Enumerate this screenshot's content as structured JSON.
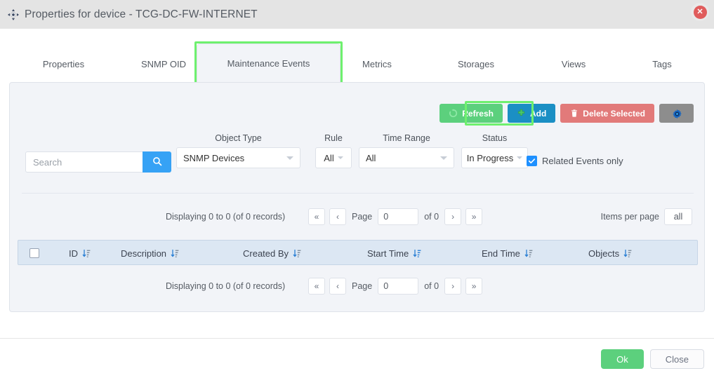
{
  "window": {
    "title": "Properties for device - TCG-DC-FW-INTERNET",
    "title_icon": "move-resize-icon",
    "close_icon": "close-circle-icon",
    "accent_green": "#6ef06e",
    "accent_blue": "#1b8fc4",
    "accent_red": "#e27a7a",
    "accent_success": "#5cd07d"
  },
  "tabs": [
    {
      "label": "Properties",
      "active": false
    },
    {
      "label": "SNMP OID",
      "active": false
    },
    {
      "label": "Maintenance Events",
      "active": true
    },
    {
      "label": "Metrics",
      "active": false
    },
    {
      "label": "Storages",
      "active": false
    },
    {
      "label": "Views",
      "active": false
    },
    {
      "label": "Tags",
      "active": false
    }
  ],
  "toolbar": {
    "refresh_label": "Refresh",
    "refresh_icon": "refresh-icon",
    "add_label": "Add",
    "add_icon": "plus-icon",
    "delete_label": "Delete Selected",
    "delete_icon": "trash-icon",
    "settings_icon": "gear-icon"
  },
  "filters": {
    "search_value": "",
    "search_placeholder": "Search",
    "search_icon": "search-icon",
    "object_type": {
      "label": "Object Type",
      "value": "SNMP Devices"
    },
    "rule": {
      "label": "Rule",
      "value": "All"
    },
    "time_range": {
      "label": "Time Range",
      "value": "All"
    },
    "status": {
      "label": "Status",
      "value": "In Progress"
    },
    "related_events": {
      "label": "Related Events only",
      "checked": true
    }
  },
  "pager": {
    "count_text": "Displaying 0 to 0 (of 0 records)",
    "first_label": "«",
    "prev_label": "‹",
    "page_label": "Page",
    "page_value": "0",
    "of_label": "of 0",
    "next_label": "›",
    "last_label": "»",
    "items_per_page_label": "Items per page",
    "items_per_page_value": "all"
  },
  "table": {
    "columns": [
      {
        "label": "ID",
        "sorted": false
      },
      {
        "label": "Description",
        "sorted": false
      },
      {
        "label": "Created By",
        "sorted": false
      },
      {
        "label": "Start Time",
        "sorted": true
      },
      {
        "label": "End Time",
        "sorted": false
      },
      {
        "label": "Objects",
        "sorted": false
      }
    ],
    "select_all_checked": false,
    "rows": []
  },
  "footer": {
    "ok_label": "Ok",
    "close_label": "Close"
  }
}
